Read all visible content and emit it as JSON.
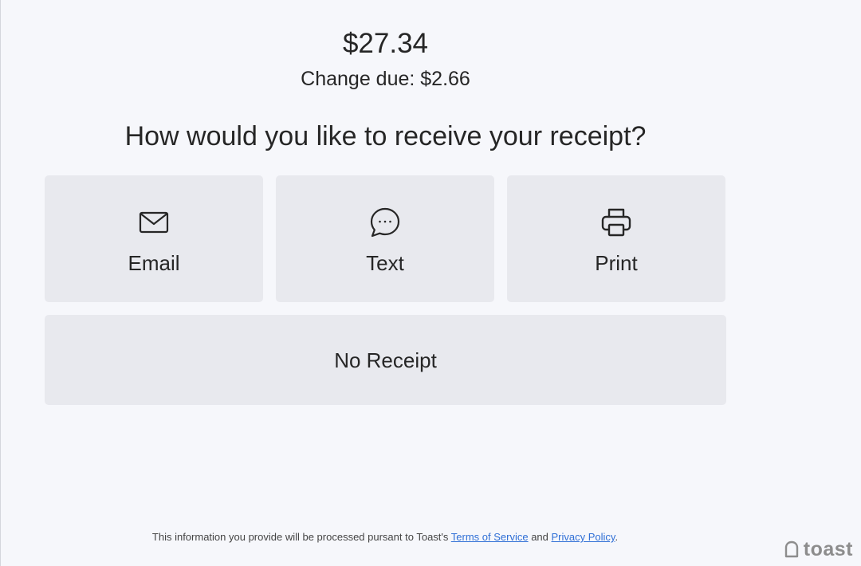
{
  "payment": {
    "total": "$27.34",
    "change_due": "Change due: $2.66"
  },
  "prompt": "How would you like to receive your receipt?",
  "options": [
    {
      "label": "Email",
      "icon": "envelope-icon"
    },
    {
      "label": "Text",
      "icon": "chat-bubble-icon"
    },
    {
      "label": "Print",
      "icon": "printer-icon"
    }
  ],
  "no_receipt_label": "No Receipt",
  "footer": {
    "text_before": "This information you provide will be processed pursant to Toast's ",
    "terms_link": "Terms of Service",
    "text_and": " and ",
    "privacy_link": "Privacy Policy",
    "text_after": "."
  },
  "brand": {
    "logo_text": "toast",
    "logo_icon": "toast-logo-icon"
  },
  "colors": {
    "background": "#f6f7fb",
    "button_bg": "#e8e9ee",
    "text": "#262626",
    "link": "#2f6fd6",
    "logo": "#8d8d8d"
  }
}
